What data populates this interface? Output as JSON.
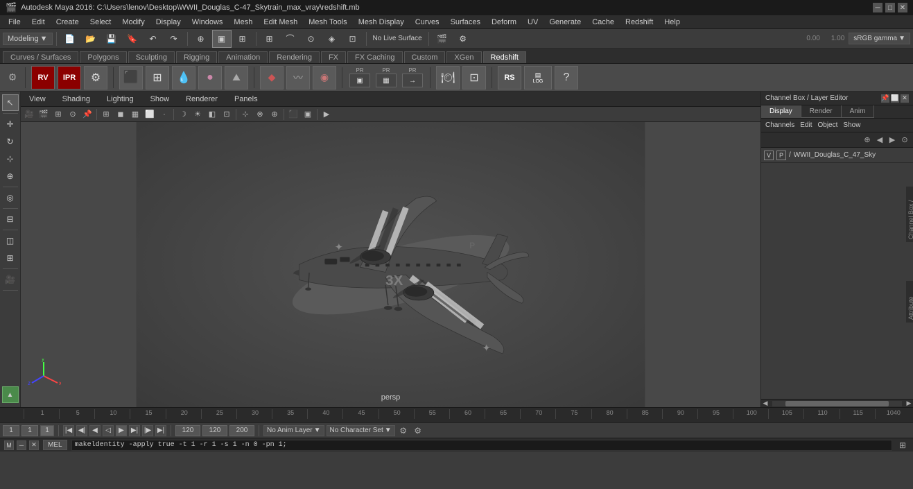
{
  "titlebar": {
    "title": "Autodesk Maya 2016: C:\\Users\\lenov\\Desktop\\WWII_Douglas_C-47_Skytrain_max_vray\\redshift.mb",
    "icon": "🎬",
    "min_label": "─",
    "max_label": "□",
    "close_label": "✕"
  },
  "menubar": {
    "items": [
      "File",
      "Edit",
      "Create",
      "Select",
      "Modify",
      "Display",
      "Windows",
      "Mesh",
      "Edit Mesh",
      "Mesh Tools",
      "Mesh Display",
      "Curves",
      "Surfaces",
      "Deform",
      "UV",
      "Generate",
      "Cache",
      "Redshift",
      "Help"
    ]
  },
  "toolbar1": {
    "mode_label": "Modeling",
    "dropdown_arrow": "▼",
    "no_live_surface": "No Live Surface"
  },
  "shelf": {
    "tabs": [
      "Curves / Surfaces",
      "Polygons",
      "Sculpting",
      "Rigging",
      "Animation",
      "Rendering",
      "FX",
      "FX Caching",
      "Custom",
      "XGen",
      "Redshift"
    ],
    "active_tab": "Redshift"
  },
  "viewport": {
    "menus": [
      "View",
      "Shading",
      "Lighting",
      "Show",
      "Renderer",
      "Panels"
    ],
    "persp_label": "persp",
    "coord_x": "0.00",
    "coord_y": "1.00",
    "gamma_label": "sRGB gamma"
  },
  "channel_box": {
    "title": "Channel Box / Layer Editor",
    "tabs": [
      "Display",
      "Render",
      "Anim"
    ],
    "active_tab": "Display",
    "menu_items": [
      "Channels",
      "Edit",
      "Object",
      "Show"
    ],
    "layer_name": "WWII_Douglas_C_47_Sky",
    "layer_v": "V",
    "layer_p": "P",
    "layer_path": "/ \\"
  },
  "timeline": {
    "ticks": [
      "",
      "5",
      "10",
      "15",
      "20",
      "25",
      "30",
      "35",
      "40",
      "45",
      "50",
      "55",
      "60",
      "65",
      "70",
      "75",
      "80",
      "85",
      "90",
      "95",
      "100",
      "105",
      "110",
      "115",
      "1040"
    ]
  },
  "playback": {
    "start_frame": "1",
    "current_frame": "1",
    "frame_indicator": "1",
    "end_frame1": "120",
    "end_frame2": "120",
    "max_frame": "200",
    "no_anim_layer": "No Anim Layer",
    "no_char_set": "No Character Set"
  },
  "statusbar": {
    "mode_label": "MEL",
    "command": "makeldentity -apply true -t 1 -r 1 -s 1 -n 0 -pn 1;"
  },
  "rp_sidebar": {
    "channel_box_label": "Channel Box / Layer Editor",
    "attr_editor_label": "Attribute Editor"
  }
}
